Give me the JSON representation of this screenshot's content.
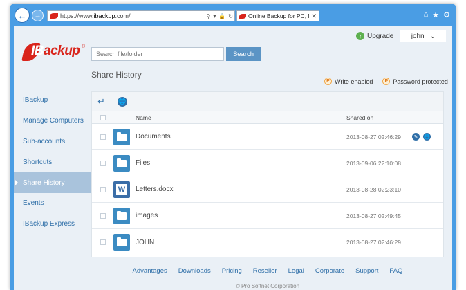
{
  "browser": {
    "url_prefix": "https://www.",
    "url_host": "ibackup",
    "url_suffix": ".com/",
    "tab_title": "Online Backup for PC, Mac ..."
  },
  "brand": {
    "name_red": "IB",
    "name_rest": "ackup",
    "reg": "®"
  },
  "topbar": {
    "upgrade_label": "Upgrade",
    "user_name": "john"
  },
  "search": {
    "placeholder": "Search file/folder",
    "button_label": "Search"
  },
  "page_title": "Share History",
  "legend": {
    "write": {
      "badge": "E",
      "label": "Write enabled"
    },
    "password": {
      "badge": "P",
      "label": "Password protected"
    }
  },
  "sidebar": {
    "items": [
      {
        "label": "IBackup"
      },
      {
        "label": "Manage Computers"
      },
      {
        "label": "Sub-accounts"
      },
      {
        "label": "Shortcuts"
      },
      {
        "label": "Share History"
      },
      {
        "label": "Events"
      },
      {
        "label": "IBackup Express"
      }
    ]
  },
  "table": {
    "headers": {
      "name": "Name",
      "shared_on": "Shared on"
    },
    "rows": [
      {
        "name": "Documents",
        "date": "2013-08-27 02:46:29",
        "type": "folder"
      },
      {
        "name": "Files",
        "date": "2013-09-06 22:10:08",
        "type": "folder"
      },
      {
        "name": "Letters.docx",
        "date": "2013-08-28 02:23:10",
        "type": "doc"
      },
      {
        "name": "images",
        "date": "2013-08-27 02:49:45",
        "type": "folder"
      },
      {
        "name": "JOHN",
        "date": "2013-08-27 02:46:29",
        "type": "folder"
      }
    ]
  },
  "footer": {
    "links": [
      "Advantages",
      "Downloads",
      "Pricing",
      "Reseller",
      "Legal",
      "Corporate",
      "Support",
      "FAQ"
    ],
    "copyright": "© Pro Softnet Corporation"
  }
}
